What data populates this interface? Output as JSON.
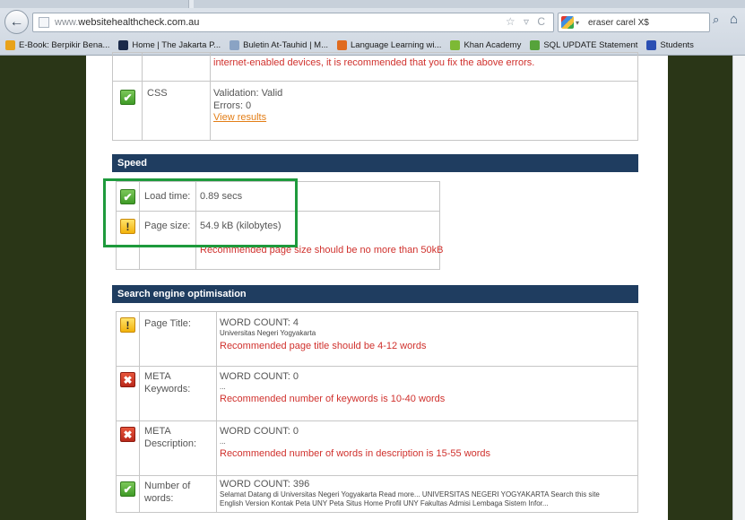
{
  "browser": {
    "back_glyph": "←",
    "url_prefix": "www.",
    "url_domain": "websitehealthcheck.com.au",
    "url_tools": "☆ ▿ C",
    "search_value": "eraser carel X$",
    "search_engine_caret": "▾",
    "search_glyph": "⌕",
    "home_glyph": "⌂"
  },
  "bookmarks": [
    {
      "label": "E-Book: Berpikir Bena...",
      "icon": "bookmark-arrow-icon",
      "color": "#e8a21a"
    },
    {
      "label": "Home | The Jakarta P...",
      "icon": "jakarta-post-icon",
      "color": "#1b2a4a"
    },
    {
      "label": "Buletin At-Tauhid | M...",
      "icon": "document-icon",
      "color": "#8aa3c4"
    },
    {
      "label": "Language Learning wi...",
      "icon": "language-icon",
      "color": "#e06b1f"
    },
    {
      "label": "Khan Academy",
      "icon": "leaf-icon",
      "color": "#7db935"
    },
    {
      "label": "SQL UPDATE Statement",
      "icon": "w3-icon",
      "color": "#56a33b"
    },
    {
      "label": "Students",
      "icon": "students-icon",
      "color": "#2b4fb3"
    }
  ],
  "mobile": {
    "partial_red_text": "internet-enabled devices, it is recommended that you fix the above errors."
  },
  "css": {
    "label": "CSS",
    "validation": "Validation: Valid",
    "errors": "Errors: 0",
    "view_results": "View results",
    "status": "ok"
  },
  "speed": {
    "title": "Speed",
    "load_label": "Load time:",
    "load_value": "0.89 secs",
    "page_label": "Page size:",
    "page_value": "54.9 kB (kilobytes)",
    "page_recommend": "Recommended page size should be no more than 50kB"
  },
  "seo": {
    "title": "Search engine optimisation",
    "page_title": {
      "label": "Page Title:",
      "count": "WORD COUNT: 4",
      "detail": "Universitas Negeri Yogyakarta",
      "recommend": "Recommended page title should be 4-12 words"
    },
    "meta_keywords": {
      "label_line1": "META",
      "label_line2": "Keywords:",
      "count": "WORD COUNT: 0",
      "detail": "...",
      "recommend": "Recommended number of keywords is 10-40 words"
    },
    "meta_description": {
      "label_line1": "META",
      "label_line2": "Description:",
      "count": "WORD COUNT: 0",
      "detail": "...",
      "recommend": "Recommended number of words in description is 15-55 words"
    },
    "number_of_words": {
      "label_line1": "Number of",
      "label_line2": "words:",
      "count": "WORD COUNT: 396",
      "detail_line1": "Selamat Datang di Universitas Negeri Yogyakarta Read more... UNIVERSITAS NEGERI YOGYAKARTA Search this site",
      "detail_line2": "English Version Kontak Peta UNY Peta Situs Home Profil UNY Fakultas Admisi Lembaga Sistem Infor..."
    }
  },
  "icon_glyphs": {
    "ok": "✔",
    "warn": "!",
    "err": "✖"
  },
  "colors": {
    "section_header": "#1f3d60",
    "highlight_box": "#1e9a3c",
    "recommend_text": "#d0312d",
    "link": "#e37e16",
    "page_background": "#2a3617"
  }
}
